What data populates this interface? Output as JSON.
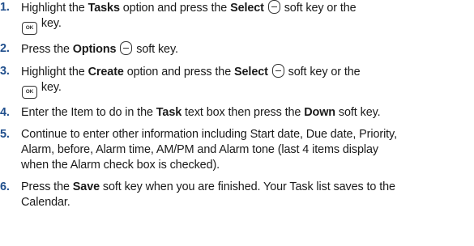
{
  "steps": [
    {
      "num": "1.",
      "parts": [
        {
          "t": "Highlight the "
        },
        {
          "t": "Tasks",
          "b": true
        },
        {
          "t": " option and press the "
        },
        {
          "t": "Select",
          "b": true
        },
        {
          "t": " "
        },
        {
          "icon": "soft-key"
        },
        {
          "t": " soft key or the"
        },
        {
          "br": true
        },
        {
          "icon": "ok-key"
        },
        {
          "t": " key."
        }
      ]
    },
    {
      "num": "2.",
      "parts": [
        {
          "t": "Press the "
        },
        {
          "t": "Options",
          "b": true
        },
        {
          "t": " "
        },
        {
          "icon": "soft-key"
        },
        {
          "t": " soft key."
        }
      ]
    },
    {
      "num": "3.",
      "parts": [
        {
          "t": "Highlight the "
        },
        {
          "t": "Create",
          "b": true
        },
        {
          "t": " option and press the "
        },
        {
          "t": "Select",
          "b": true
        },
        {
          "t": " "
        },
        {
          "icon": "soft-key"
        },
        {
          "t": " soft key or the"
        },
        {
          "br": true
        },
        {
          "icon": "ok-key"
        },
        {
          "t": " key."
        }
      ]
    },
    {
      "num": "4.",
      "parts": [
        {
          "t": "Enter the Item to do in the "
        },
        {
          "t": "Task",
          "b": true
        },
        {
          "t": " text box then press the "
        },
        {
          "t": "Down",
          "b": true
        },
        {
          "t": " soft key."
        }
      ]
    },
    {
      "num": "5.",
      "parts": [
        {
          "t": "Continue to enter other information including Start date, Due date, Priority,"
        },
        {
          "br": true
        },
        {
          "t": "Alarm, before, Alarm time, AM/PM and Alarm tone (last 4 items display"
        },
        {
          "br": true
        },
        {
          "t": "when the Alarm check box is checked)."
        }
      ]
    },
    {
      "num": "6.",
      "parts": [
        {
          "t": "Press the "
        },
        {
          "t": "Save",
          "b": true
        },
        {
          "t": " soft key when you are finished. Your Task list saves to the"
        },
        {
          "br": true
        },
        {
          "t": "Calendar."
        }
      ]
    }
  ],
  "icons": {
    "ok_key_label": "OK",
    "soft_key": "soft-key-icon",
    "ok_key": "ok-key-icon"
  },
  "colors": {
    "step_number": "#1f4e8c",
    "text": "#1a1a1a"
  }
}
